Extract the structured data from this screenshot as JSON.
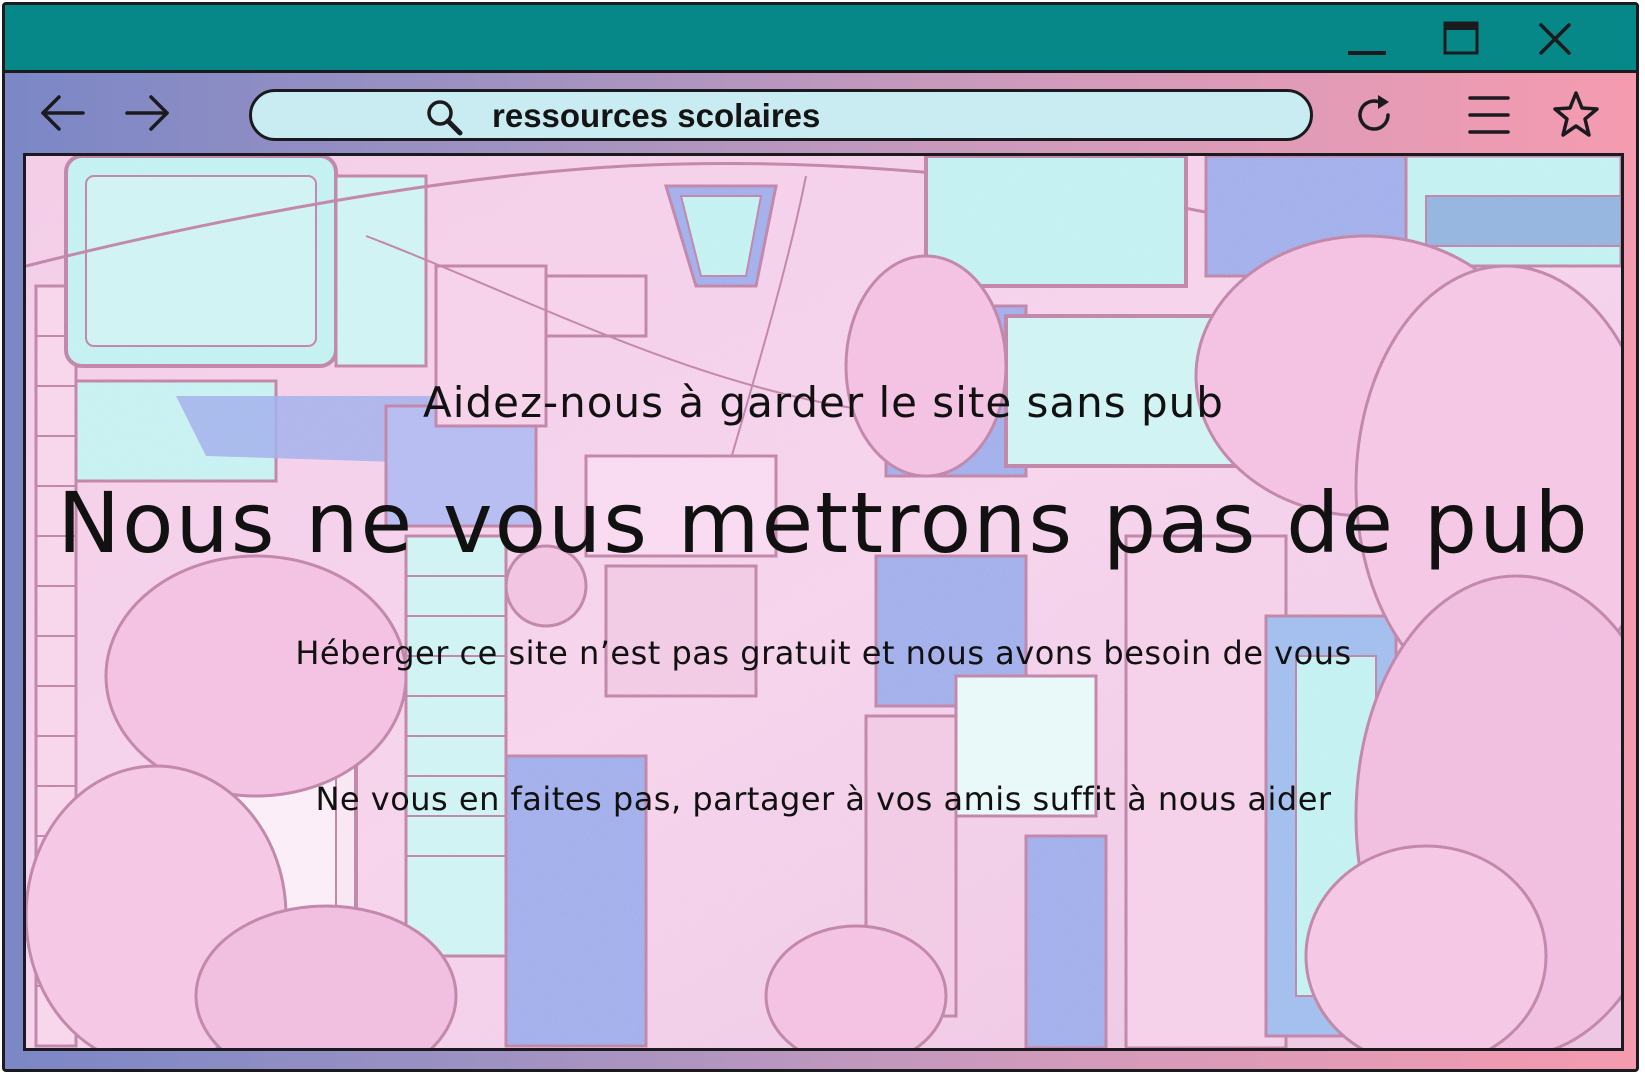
{
  "window": {
    "controls": {
      "minimize_icon": "minimize-icon",
      "maximize_icon": "maximize-icon",
      "close_icon": "close-icon"
    },
    "colors": {
      "titlebar": "#068788",
      "toolbar_gradient_start": "#7b87c6",
      "toolbar_gradient_end": "#f59bb0",
      "urlbar_fill": "#c9ecf2",
      "outline": "#1b1b1f"
    }
  },
  "toolbar": {
    "back_icon": "arrow-left-icon",
    "forward_icon": "arrow-right-icon",
    "search_icon": "search-icon",
    "search_text": "ressources scolaires",
    "reload_icon": "reload-icon",
    "menu_icon": "hamburger-menu-icon",
    "bookmark_icon": "star-icon"
  },
  "page": {
    "subtitle": "Aidez-nous à garder le site sans pub",
    "headline": "Nous ne vous mettrons pas de pub",
    "paragraph_1": "Héberger ce site n’est pas gratuit et nous avons besoin de vous",
    "paragraph_2": "Ne vous en faites pas, partager à vos amis suffit à nous aider"
  }
}
